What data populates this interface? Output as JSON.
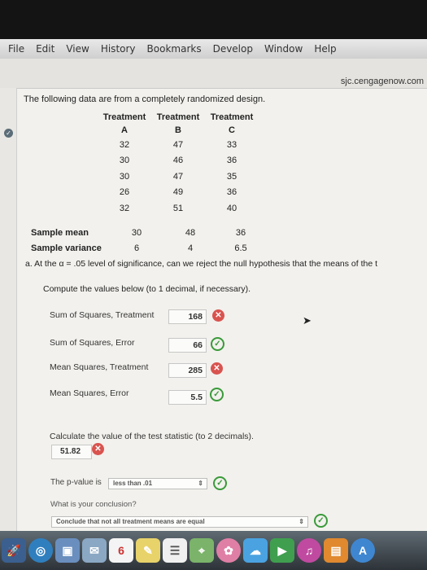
{
  "menubar": [
    "File",
    "Edit",
    "View",
    "History",
    "Bookmarks",
    "Develop",
    "Window",
    "Help"
  ],
  "browser": {
    "url": "sjc.cengagenow.com"
  },
  "problem": {
    "intro": "The following data are from a completely randomized design.",
    "treatment_header": "Treatment",
    "groups": [
      "A",
      "B",
      "C"
    ],
    "rows": [
      [
        "32",
        "47",
        "33"
      ],
      [
        "30",
        "46",
        "36"
      ],
      [
        "30",
        "47",
        "35"
      ],
      [
        "26",
        "49",
        "36"
      ],
      [
        "32",
        "51",
        "40"
      ]
    ],
    "sample_mean_label": "Sample mean",
    "sample_means": [
      "30",
      "48",
      "36"
    ],
    "sample_variance_label": "Sample variance",
    "sample_variances": [
      "6",
      "4",
      "6.5"
    ],
    "question": "a.  At the α = .05 level of significance, can we reject the null hypothesis that the means of the t",
    "instruction": "Compute the values below (to 1 decimal, if necessary).",
    "answers": [
      {
        "label": "Sum of Squares, Treatment",
        "value": "168",
        "status": "incorrect"
      },
      {
        "label": "Sum of Squares, Error",
        "value": "66",
        "status": "correct"
      },
      {
        "label": "Mean Squares, Treatment",
        "value": "285",
        "status": "incorrect"
      },
      {
        "label": "Mean Squares, Error",
        "value": "5.5",
        "status": "correct"
      }
    ],
    "test_statistic_label": "Calculate the value of the test statistic (to 2 decimals).",
    "test_statistic_value": "51.82",
    "pvalue_prefix": "The p-value is",
    "pvalue_selected": "less than .01",
    "conclusion_label": "What is your conclusion?",
    "conclusion_selected": "Conclude that not all treatment means are equal"
  },
  "dock": {
    "calendar_day": "6",
    "icons": [
      "launchpad-icon",
      "safari-icon",
      "preview-icon",
      "mail-icon",
      "calendar-icon",
      "notes-icon",
      "reminders-icon",
      "maps-icon",
      "photos-icon",
      "messages-icon",
      "facetime-icon",
      "itunes-icon",
      "ibooks-icon",
      "app-store-icon"
    ]
  },
  "colors": {
    "correct": "#3a9a3a",
    "incorrect": "#d9534f"
  }
}
